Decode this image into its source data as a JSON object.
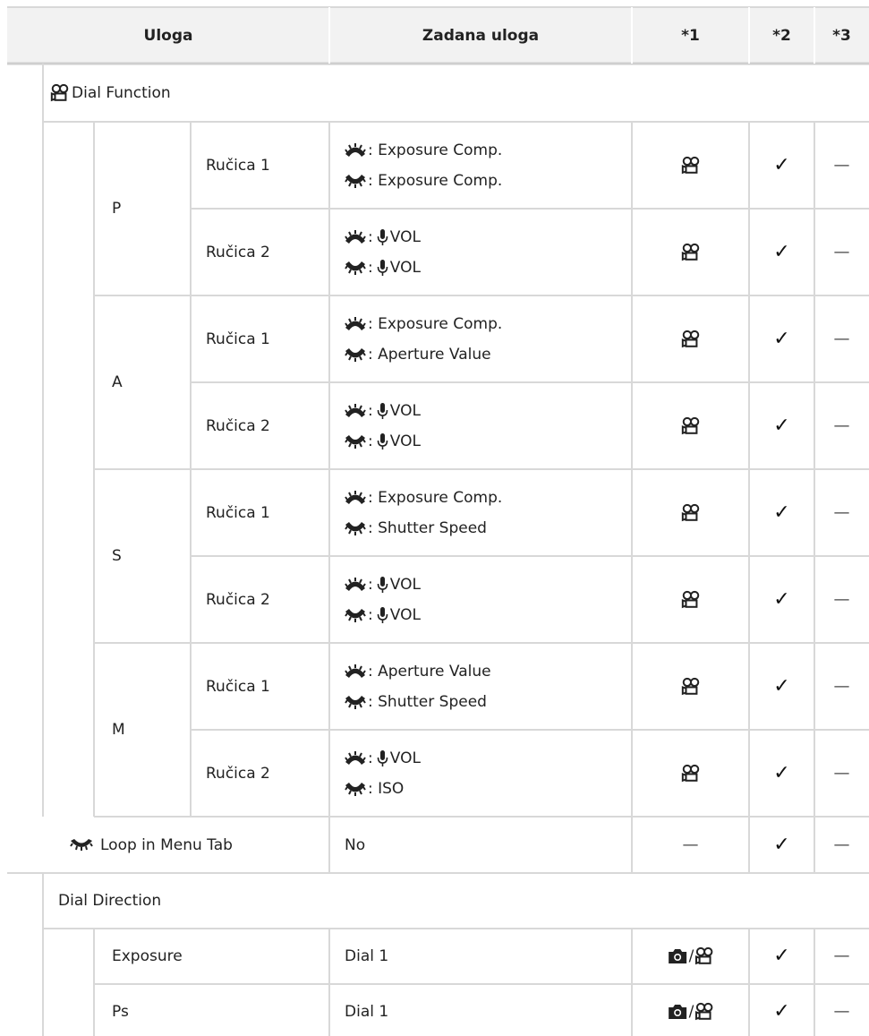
{
  "header": {
    "role": "Uloga",
    "default_role": "Zadana uloga",
    "col1": "*1",
    "col2": "*2",
    "col3": "*3"
  },
  "dial_function": {
    "title": "Dial Function",
    "groups": [
      {
        "mode": "P",
        "rows": [
          {
            "dial": "Ručica 1",
            "front": ": Exposure Comp.",
            "rear": ": Exposure Comp.",
            "mic_front": false,
            "mic_rear": false,
            "c1": "movie",
            "c2": "✓",
            "c3": "—"
          },
          {
            "dial": "Ručica 2",
            "front": "VOL",
            "rear": "VOL",
            "mic_front": true,
            "mic_rear": true,
            "c1": "movie",
            "c2": "✓",
            "c3": "—"
          }
        ]
      },
      {
        "mode": "A",
        "rows": [
          {
            "dial": "Ručica 1",
            "front": ": Exposure Comp.",
            "rear": ": Aperture Value",
            "mic_front": false,
            "mic_rear": false,
            "c1": "movie",
            "c2": "✓",
            "c3": "—"
          },
          {
            "dial": "Ručica 2",
            "front": "VOL",
            "rear": "VOL",
            "mic_front": true,
            "mic_rear": true,
            "c1": "movie",
            "c2": "✓",
            "c3": "—"
          }
        ]
      },
      {
        "mode": "S",
        "rows": [
          {
            "dial": "Ručica 1",
            "front": ": Exposure Comp.",
            "rear": ": Shutter Speed",
            "mic_front": false,
            "mic_rear": false,
            "c1": "movie",
            "c2": "✓",
            "c3": "—"
          },
          {
            "dial": "Ručica 2",
            "front": "VOL",
            "rear": "VOL",
            "mic_front": true,
            "mic_rear": true,
            "c1": "movie",
            "c2": "✓",
            "c3": "—"
          }
        ]
      },
      {
        "mode": "M",
        "rows": [
          {
            "dial": "Ručica 1",
            "front": ": Aperture Value",
            "rear": ": Shutter Speed",
            "mic_front": false,
            "mic_rear": false,
            "c1": "movie",
            "c2": "✓",
            "c3": "—"
          },
          {
            "dial": "Ručica 2",
            "front": "VOL",
            "rear": ": ISO",
            "mic_front": true,
            "mic_rear": false,
            "c1": "movie",
            "c2": "✓",
            "c3": "—"
          }
        ]
      }
    ]
  },
  "loop": {
    "label": "Loop in Menu Tab",
    "value": "No",
    "c1": "—",
    "c2": "✓",
    "c3": "—"
  },
  "dial_direction": {
    "title": "Dial Direction",
    "rows": [
      {
        "label": "Exposure",
        "value": "Dial 1",
        "c1": "photo-movie",
        "c2": "✓",
        "c3": "—"
      },
      {
        "label": "Ps",
        "value": "Dial 1",
        "c1": "photo-movie",
        "c2": "✓",
        "c3": "—"
      }
    ]
  },
  "icons": {
    "movie": "movie-camera-icon",
    "photo": "camera-icon",
    "front_dial": "front-dial-icon",
    "rear_dial": "rear-dial-icon",
    "mic": "microphone-icon",
    "check": "checkmark-icon",
    "dash": "dash-icon"
  },
  "colors": {
    "header_bg": "#f2f2f2",
    "rule": "#d8d8d8",
    "text": "#222222"
  }
}
